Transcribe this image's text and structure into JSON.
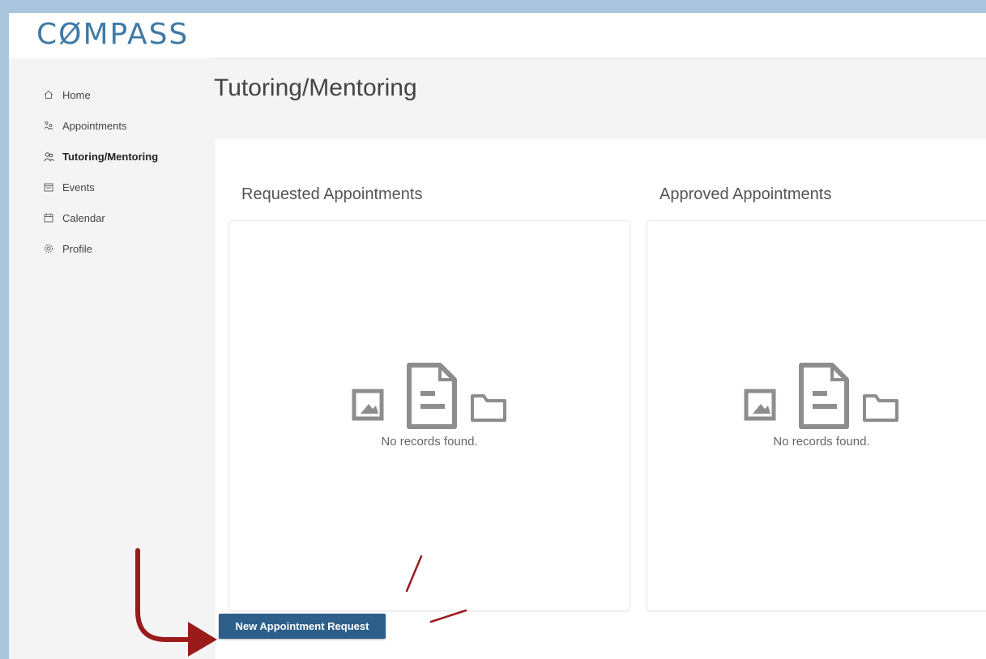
{
  "app": {
    "logo_text_1": "C",
    "logo_text_2": "Ø",
    "logo_text_3": "MPASS"
  },
  "sidebar": {
    "items": [
      {
        "label": "Home",
        "icon": "home-icon"
      },
      {
        "label": "Appointments",
        "icon": "appointments-icon"
      },
      {
        "label": "Tutoring/Mentoring",
        "icon": "people-icon",
        "active": true
      },
      {
        "label": "Events",
        "icon": "event-icon"
      },
      {
        "label": "Calendar",
        "icon": "calendar-icon"
      },
      {
        "label": "Profile",
        "icon": "gear-icon"
      }
    ]
  },
  "main": {
    "title": "Tutoring/Mentoring",
    "sections": [
      {
        "title": "Requested Appointments",
        "empty_text": "No records found."
      },
      {
        "title": "Approved Appointments",
        "empty_text": "No records found."
      }
    ],
    "new_request_label": "New Appointment Request"
  },
  "colors": {
    "brand": "#3f7aa5",
    "button": "#2d5f8a",
    "annotation": "#9b1b1b",
    "frame": "#a9c4dd"
  }
}
